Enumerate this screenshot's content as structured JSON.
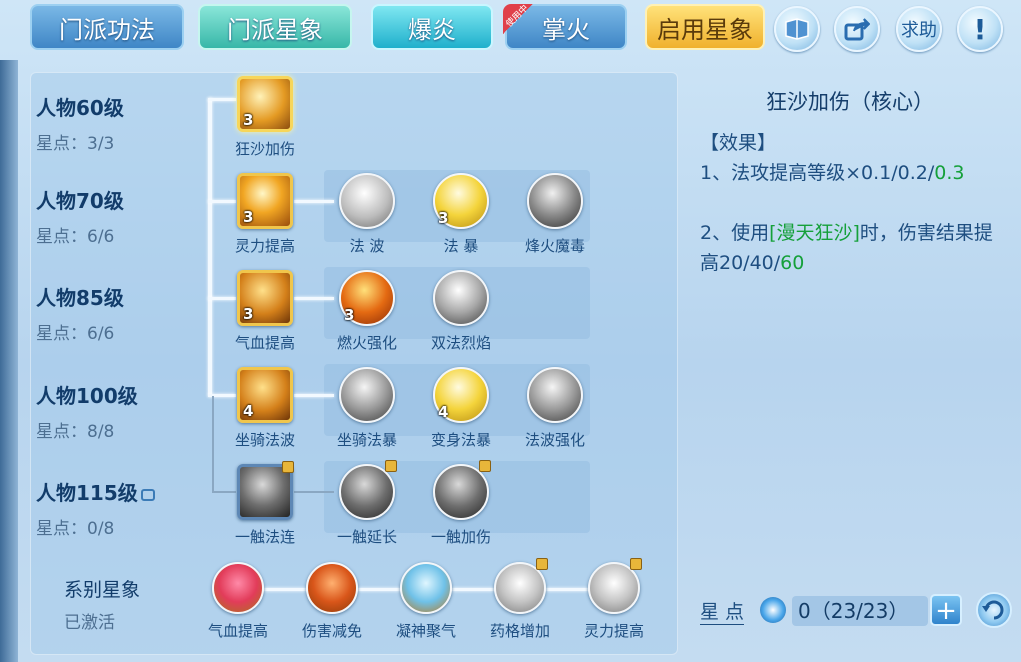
{
  "tabs": [
    {
      "label": "门派功法",
      "style": "blue"
    },
    {
      "label": "门派星象",
      "style": "teal"
    },
    {
      "label": "爆炎",
      "style": "cyan"
    },
    {
      "label": "掌火",
      "style": "blue",
      "badge": "使用中"
    },
    {
      "label": "启用星象",
      "style": "gold"
    }
  ],
  "round_buttons": [
    {
      "icon": "book-icon",
      "label": ""
    },
    {
      "icon": "share-icon",
      "label": ""
    },
    {
      "icon": "help-icon",
      "label": "求助"
    },
    {
      "icon": "alert-icon",
      "label": "!"
    }
  ],
  "levels": [
    {
      "name": "人物60级",
      "points": "星点：3/3"
    },
    {
      "name": "人物70级",
      "points": "星点：6/6"
    },
    {
      "name": "人物85级",
      "points": "星点：6/6"
    },
    {
      "name": "人物100级",
      "points": "星点：8/8"
    },
    {
      "name": "人物115级",
      "points": "星点：0/8",
      "locked": true
    }
  ],
  "skills": {
    "row1": [
      {
        "label": "狂沙加伤",
        "count": "3"
      }
    ],
    "row2": [
      {
        "label": "灵力提高",
        "count": "3"
      },
      {
        "label": "法 波",
        "count": ""
      },
      {
        "label": "法 暴",
        "count": "3"
      },
      {
        "label": "烽火魔毒",
        "count": ""
      }
    ],
    "row3": [
      {
        "label": "气血提高",
        "count": "3"
      },
      {
        "label": "燃火强化",
        "count": "3"
      },
      {
        "label": "双法烈焰",
        "count": ""
      }
    ],
    "row4": [
      {
        "label": "坐骑法波",
        "count": "4"
      },
      {
        "label": "坐骑法暴",
        "count": ""
      },
      {
        "label": "变身法暴",
        "count": "4"
      },
      {
        "label": "法波强化",
        "count": ""
      }
    ],
    "row5": [
      {
        "label": "一触法连",
        "count": ""
      },
      {
        "label": "一触延长",
        "count": ""
      },
      {
        "label": "一触加伤",
        "count": ""
      }
    ]
  },
  "system": {
    "title": "系别星象",
    "status": "已激活",
    "items": [
      {
        "label": "气血提高"
      },
      {
        "label": "伤害减免"
      },
      {
        "label": "凝神聚气"
      },
      {
        "label": "药格增加"
      },
      {
        "label": "灵力提高"
      }
    ]
  },
  "detail": {
    "title": "狂沙加伤（核心）",
    "effect_header": "【效果】",
    "line1_prefix": "1、法攻提高等级×0.1/0.2/",
    "line1_hl": "0.3",
    "line2_prefix": "2、使用",
    "line2_skill": "[漫天狂沙]",
    "line2_mid": "时，伤害结果提高20/40/",
    "line2_hl": "60"
  },
  "footer": {
    "label": "星 点",
    "value": "0（23/23）"
  },
  "colors": {
    "accent": "#15a03a",
    "text": "#1e4e80",
    "gold": "#f0c64c"
  }
}
